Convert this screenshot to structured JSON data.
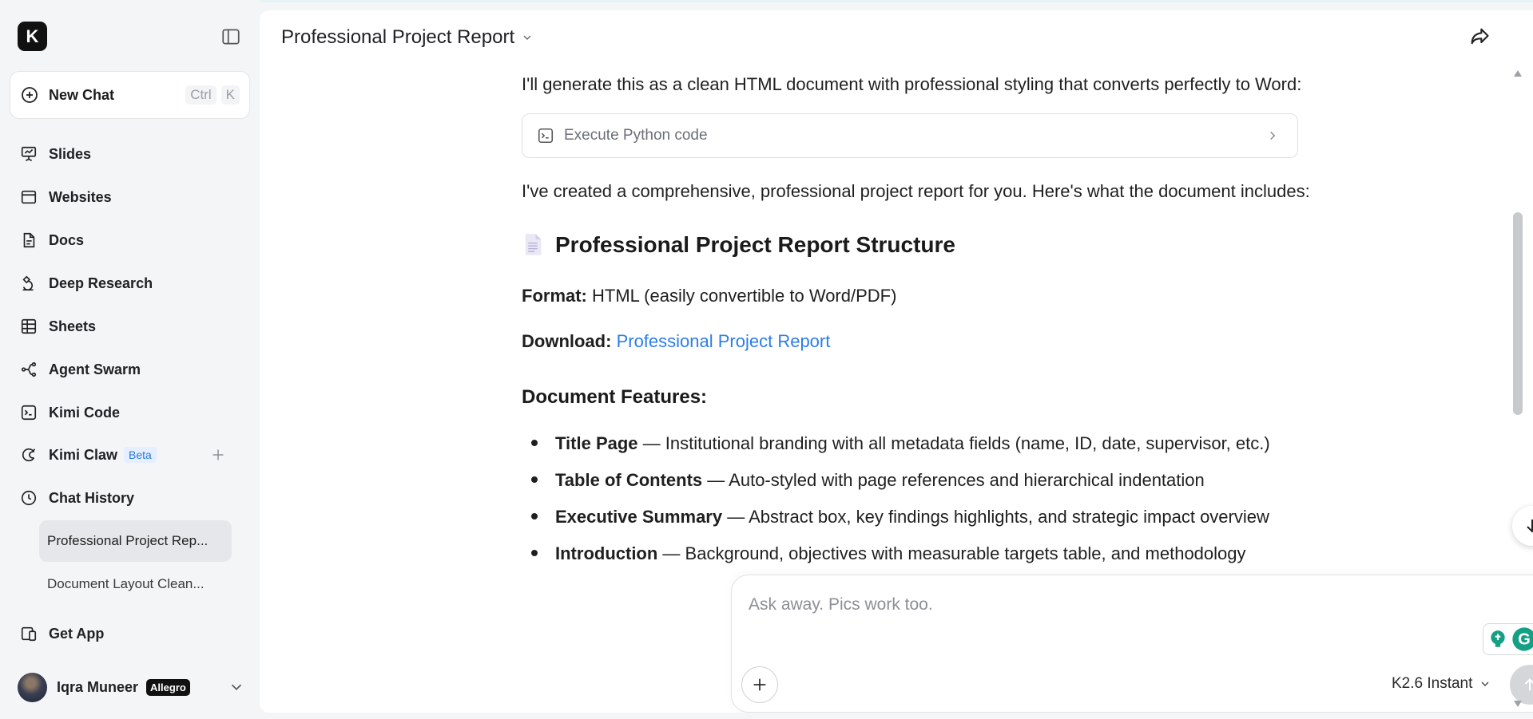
{
  "app": {
    "logo_letter": "K"
  },
  "sidebar": {
    "new_chat": {
      "label": "New Chat",
      "shortcut": [
        "Ctrl",
        "K"
      ]
    },
    "items": [
      {
        "label": "Slides",
        "icon": "slides-icon"
      },
      {
        "label": "Websites",
        "icon": "browser-window-icon"
      },
      {
        "label": "Docs",
        "icon": "document-icon"
      },
      {
        "label": "Deep Research",
        "icon": "microscope-icon"
      },
      {
        "label": "Sheets",
        "icon": "table-icon"
      },
      {
        "label": "Agent Swarm",
        "icon": "agent-swarm-icon"
      },
      {
        "label": "Kimi Code",
        "icon": "terminal-icon"
      },
      {
        "label": "Kimi Claw",
        "icon": "claw-icon",
        "badge": "Beta"
      },
      {
        "label": "Chat History",
        "icon": "clock-icon"
      }
    ],
    "history": [
      {
        "label": "Professional Project Rep...",
        "active": true
      },
      {
        "label": "Document Layout Clean...",
        "active": false
      }
    ],
    "get_app": {
      "label": "Get App",
      "icon": "device-icon"
    },
    "user": {
      "name": "Iqra Muneer",
      "plan": "Allegro"
    }
  },
  "chat": {
    "title": "Professional Project Report",
    "messages": {
      "intro": "I'll generate this as a clean HTML document with professional styling that converts perfectly to Word:",
      "tool_card": "Execute Python code",
      "summary": "I've created a comprehensive, professional project report for you. Here's what the document includes:",
      "heading": "Professional Project Report Structure",
      "format_label": "Format:",
      "format_value": " HTML (easily convertible to Word/PDF)",
      "download_label": "Download:",
      "download_link": "Professional Project Report",
      "features_heading": "Document Features:",
      "features": [
        {
          "name": "Title Page",
          "desc": " — Institutional branding with all metadata fields (name, ID, date, supervisor, etc.)"
        },
        {
          "name": "Table of Contents",
          "desc": " — Auto-styled with page references and hierarchical indentation"
        },
        {
          "name": "Executive Summary",
          "desc": " — Abstract box, key findings highlights, and strategic impact overview"
        },
        {
          "name": "Introduction",
          "desc": " — Background, objectives with measurable targets table, and methodology"
        }
      ]
    }
  },
  "composer": {
    "placeholder": "Ask away. Pics work too.",
    "model": "K2.6 Instant"
  },
  "colors": {
    "link": "#2b7de9",
    "beta_bg": "#e5efff",
    "beta_text": "#2a79d8",
    "grammarly": "#15a085"
  }
}
